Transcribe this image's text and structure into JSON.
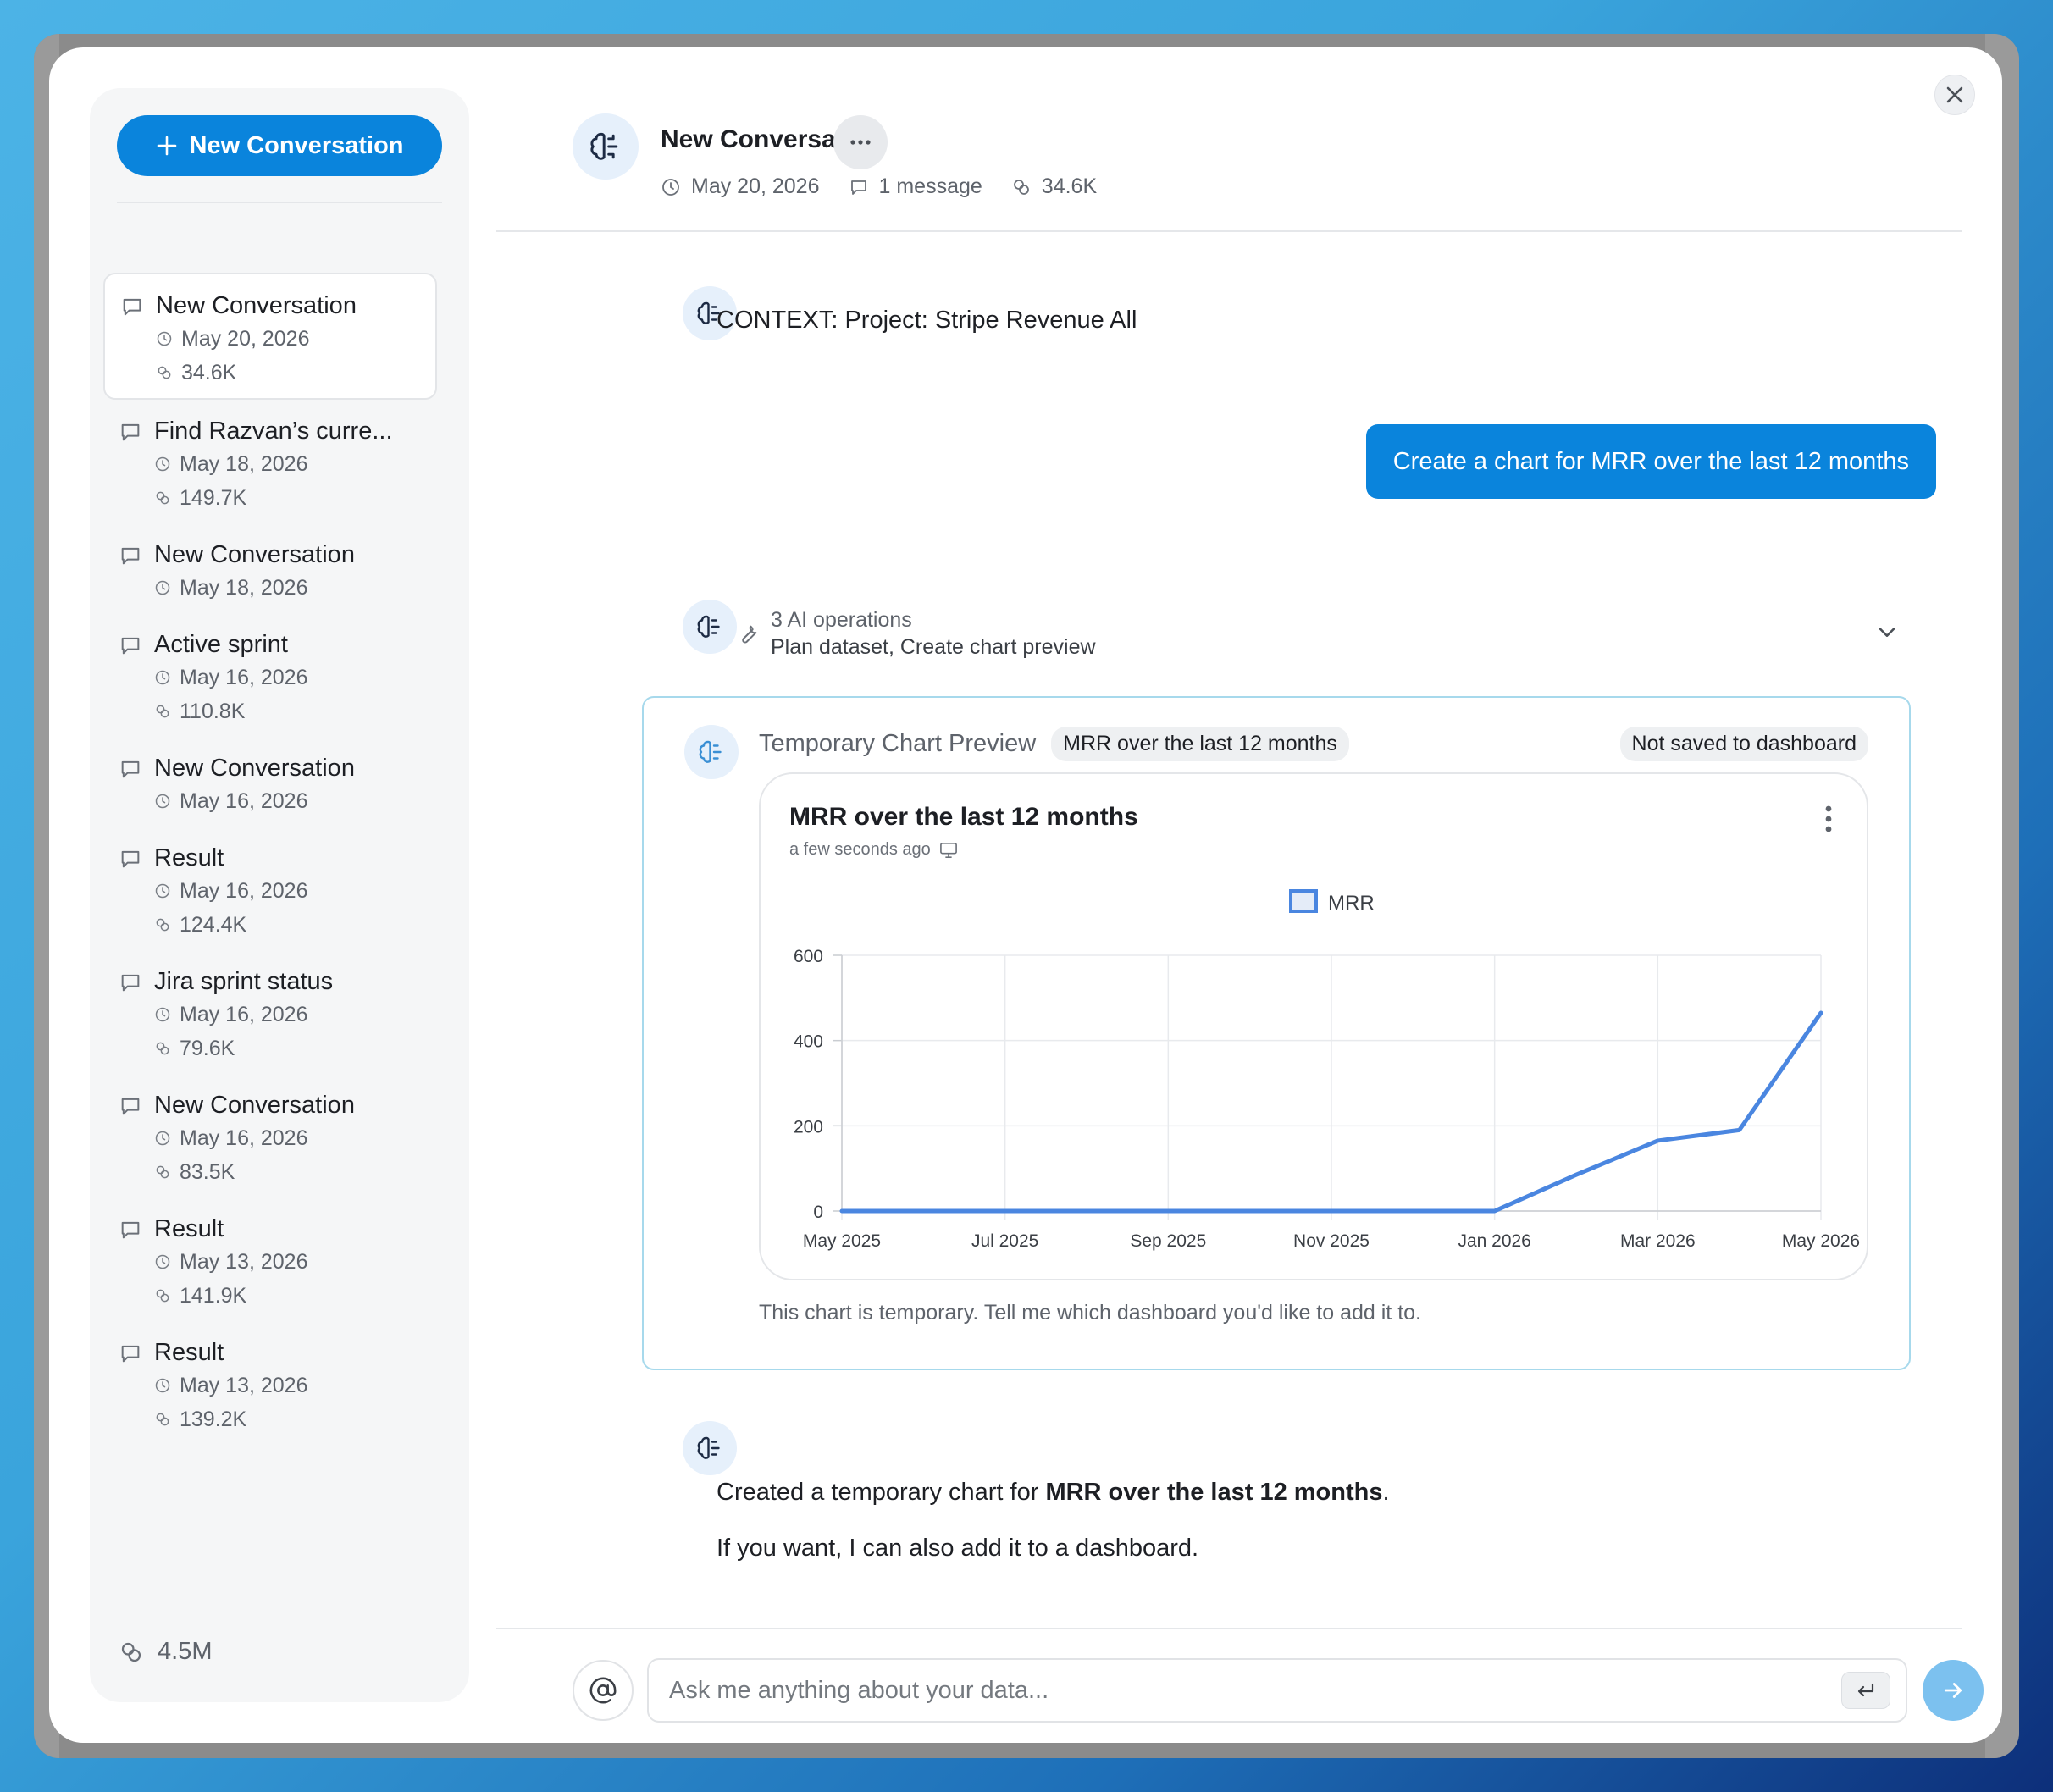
{
  "sidebar": {
    "new_button_label": "New Conversation",
    "conversations": [
      {
        "title": "New Conversation",
        "date": "May 20, 2026",
        "tokens": "34.6K"
      },
      {
        "title": "Find Razvan’s curre...",
        "date": "May 18, 2026",
        "tokens": "149.7K"
      },
      {
        "title": "New Conversation",
        "date": "May 18, 2026",
        "tokens": ""
      },
      {
        "title": "Active sprint",
        "date": "May 16, 2026",
        "tokens": "110.8K"
      },
      {
        "title": "New Conversation",
        "date": "May 16, 2026",
        "tokens": ""
      },
      {
        "title": "Result",
        "date": "May 16, 2026",
        "tokens": "124.4K"
      },
      {
        "title": "Jira sprint status",
        "date": "May 16, 2026",
        "tokens": "79.6K"
      },
      {
        "title": "New Conversation",
        "date": "May 16, 2026",
        "tokens": "83.5K"
      },
      {
        "title": "Result",
        "date": "May 13, 2026",
        "tokens": "141.9K"
      },
      {
        "title": "Result",
        "date": "May 13, 2026",
        "tokens": "139.2K"
      }
    ],
    "total_tokens": "4.5M"
  },
  "header": {
    "title": "New Conversation",
    "date": "May 20, 2026",
    "messages": "1 message",
    "tokens": "34.6K"
  },
  "messages": {
    "context": "CONTEXT: Project: Stripe Revenue All",
    "user_prompt": "Create a chart for MRR over the last 12 months",
    "ops_title": "3 AI operations",
    "ops_detail": "Plan dataset, Create chart preview",
    "reply_prefix": "Created a temporary chart for ",
    "reply_bold": "MRR over the last 12 months",
    "reply_suffix": ".",
    "reply_line2": "If you want, I can also add it to a dashboard."
  },
  "preview": {
    "label": "Temporary Chart Preview",
    "chip": "MRR over the last 12 months",
    "status": "Not saved to dashboard",
    "chart_title": "MRR over the last 12 months",
    "chart_subtitle": "a few seconds ago",
    "footer": "This chart is temporary. Tell me which dashboard you'd like to add it to."
  },
  "chart_data": {
    "type": "line",
    "title": "MRR over the last 12 months",
    "xlabel": "",
    "ylabel": "",
    "ylim": [
      0,
      600
    ],
    "yticks": [
      0,
      200,
      400,
      600
    ],
    "x_tick_labels": [
      "May 2025",
      "Jul 2025",
      "Sep 2025",
      "Nov 2025",
      "Jan 2026",
      "Mar 2026",
      "May 2026"
    ],
    "x": [
      "May 2025",
      "Jun 2025",
      "Jul 2025",
      "Aug 2025",
      "Sep 2025",
      "Oct 2025",
      "Nov 2025",
      "Dec 2025",
      "Jan 2026",
      "Feb 2026",
      "Mar 2026",
      "Apr 2026",
      "May 2026"
    ],
    "series": [
      {
        "name": "MRR",
        "values": [
          0,
          0,
          0,
          0,
          0,
          0,
          0,
          0,
          0,
          85,
          165,
          190,
          465
        ]
      }
    ],
    "legend": "top-center",
    "grid": true,
    "color": "#4a86e0"
  },
  "input": {
    "placeholder": "Ask me anything about your data..."
  },
  "colors": {
    "accent": "#0a84dc",
    "send_button": "#7cc1ef",
    "preview_border": "#a7d9ec"
  }
}
